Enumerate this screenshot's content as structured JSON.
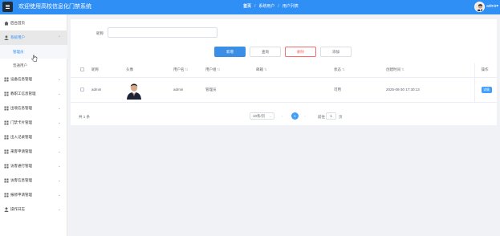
{
  "header": {
    "title": "欢迎使用高校信息化门禁系统",
    "breadcrumbs": [
      "首页",
      "系统用户",
      "用户列表"
    ],
    "user_name": "admin",
    "user_caret": "▾"
  },
  "sidebar": {
    "items": [
      {
        "label": "后台首页",
        "icon": "home-icon"
      },
      {
        "label": "系统用户",
        "icon": "user-icon",
        "open": true
      },
      {
        "label": "设备信息管理",
        "icon": "grid-icon"
      },
      {
        "label": "教职工信息管理",
        "icon": "grid-icon"
      },
      {
        "label": "出境信息管理",
        "icon": "grid-icon"
      },
      {
        "label": "门禁卡片管理",
        "icon": "grid-icon"
      },
      {
        "label": "出入记录管理",
        "icon": "grid-icon"
      },
      {
        "label": "来客申请管理",
        "icon": "grid-icon"
      },
      {
        "label": "访客通行管理",
        "icon": "grid-icon"
      },
      {
        "label": "访客信息管理",
        "icon": "grid-icon"
      },
      {
        "label": "报修申请管理",
        "icon": "grid-icon"
      },
      {
        "label": "操作日志",
        "icon": "person-icon"
      }
    ],
    "subitems": [
      "管理员",
      "普通用户"
    ],
    "chevron_down": "⌄",
    "chevron_up": "⌃"
  },
  "search": {
    "label": "昵称",
    "value": "",
    "placeholder": ""
  },
  "toolbar": {
    "add_label": "新增",
    "query_label": "查询",
    "delete_label": "删除",
    "add2_label": "添加"
  },
  "table": {
    "headers": [
      "昵称",
      "头像",
      "用户名",
      "用户组",
      "邮箱",
      "状态",
      "创建时间",
      "操作"
    ],
    "sort_mark": "⇅",
    "rows": [
      {
        "nickname": "admin",
        "username": "admin",
        "group": "管理员",
        "email": "",
        "status": "可用",
        "created": "2025-08-30 17:30:13",
        "action": "详情"
      }
    ]
  },
  "pagination": {
    "total": "共 1 条",
    "page_size": "10条/页",
    "page_size_caret": "⌄",
    "prev": "‹",
    "current": "1",
    "next": "›",
    "goto_label": "前往",
    "goto_value": "1",
    "page_unit": "页"
  },
  "colors": {
    "primary": "#2f8ff5",
    "danger": "#f56c6c",
    "sidebar_active": "#2f8ff5"
  }
}
